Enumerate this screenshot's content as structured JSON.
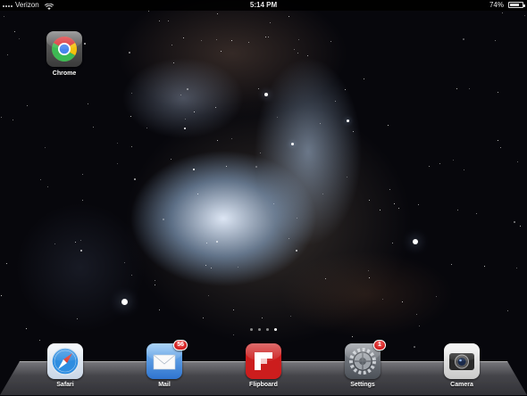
{
  "status_bar": {
    "carrier": "Verizon",
    "time": "5:14 PM",
    "battery_percent": "74%",
    "battery_level": 0.74,
    "icons": [
      "signal-icon",
      "wifi-icon",
      "battery-icon"
    ]
  },
  "home_apps": [
    {
      "label": "Chrome",
      "icon": "chrome-icon"
    }
  ],
  "page_indicator": {
    "pages": 4,
    "active_index": 3
  },
  "dock_apps": [
    {
      "label": "Safari",
      "icon": "safari-icon"
    },
    {
      "label": "Mail",
      "icon": "mail-icon",
      "badge": "56"
    },
    {
      "label": "Flipboard",
      "icon": "flipboard-icon"
    },
    {
      "label": "Settings",
      "icon": "settings-icon",
      "badge": "1"
    },
    {
      "label": "Camera",
      "icon": "camera-icon"
    }
  ],
  "colors": {
    "badge": "#d40000",
    "flipboard": "#cc1d1d",
    "safari": "#2e8de0",
    "mail": "#4a8fe0"
  }
}
